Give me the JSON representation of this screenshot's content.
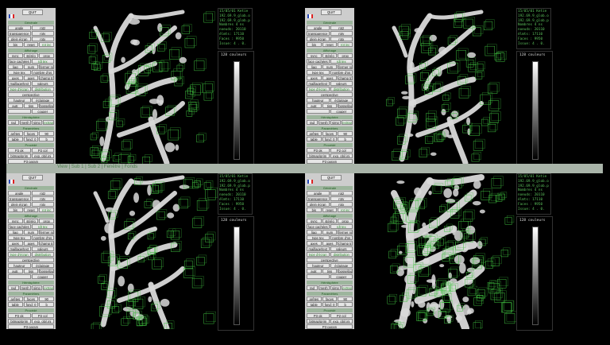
{
  "strip": {
    "label": "View  | Sub 1 | Sub 2 | Fenêtre | Fonds"
  },
  "panel": {
    "quit": "QUIT",
    "section1": "Générale",
    "rows1": [
      [
        "angle",
        "rotz"
      ],
      [
        "transparence",
        "roty"
      ],
      [
        "plein écran",
        "rotx"
      ],
      [
        "bis",
        "reset",
        "rot inc"
      ]
    ],
    "section2": "Affichage",
    "rows2": [
      [
        "sync",
        "stéréo",
        "prop"
      ],
      [
        "face cachées",
        "rdt tex"
      ],
      [
        "liag",
        "num",
        "fermer no"
      ],
      [
        "type tex",
        "nombre d'os"
      ],
      [
        "axes",
        "axes",
        "champ tracé"
      ],
      [
        "maillage/text",
        "valeurs"
      ],
      [
        "type d'écran",
        "distribution"
      ],
      [
        "perspective"
      ],
      [
        "hauteur",
        "éclairage"
      ],
      [
        "autr.",
        "tiss",
        "bossellage"
      ],
      [
        "",
        "couper"
      ]
    ],
    "section3": "Hémisphère",
    "rows3": [
      [
        "rad",
        "mesh",
        "simp",
        "extrap"
      ]
    ],
    "section4": "Paramètres",
    "rows4": [
      [
        "arêtes",
        "faces",
        "90"
      ],
      [
        "table",
        "fond: 0",
        "b"
      ]
    ],
    "section5": "Procédé",
    "rows5": [
      [
        "P3 ok",
        "P2 col"
      ],
      [
        "bitmap/prim",
        "exp. obj/.ini"
      ],
      [
        "P3 param"
      ]
    ]
  },
  "views": [
    {
      "id": "tl",
      "info": [
        "15/05/01 Ketie",
        "192.69.9_glob.o",
        "192.69.9_glob.p",
        "Nombres 4 ns",
        "noeuds: 20110",
        "élmts: 17110",
        "Faces : 9950",
        "Issue: 4 . 0."
      ]
    },
    {
      "id": "tr",
      "info": [
        "15/05/01 Ketie",
        "192.69.9_glob.o",
        "192.69.9_glob.p",
        "Nombres 4 ns",
        "noeuds: 20110",
        "élmts: 17110",
        "Faces : 9950",
        "Issue: 4 . 0."
      ]
    },
    {
      "id": "bl",
      "info": [
        "15/05/01 Ketie",
        "192.69.9_glob.o",
        "192.69.9_glob.p",
        "Nombres 4 ns",
        "noeuds: 20110",
        "élmts: 17110",
        "Faces : 9950",
        "Issue: 4 . 0."
      ]
    },
    {
      "id": "br",
      "info": [
        "15/05/01 Ketie",
        "192.69.9_glob.o",
        "192.69.9_glob.p",
        "Nombres 4 ns",
        "noeuds: 20110",
        "élmts: 17110",
        "Faces : 9950",
        "Issue: 4 . 0."
      ]
    }
  ],
  "colorbar": {
    "title": "128 couleurs"
  },
  "colors": {
    "mesh": "#3fbf3f",
    "bone": "#d9d9d9",
    "panel": "#cdcdcd",
    "header": "#9db59d"
  }
}
